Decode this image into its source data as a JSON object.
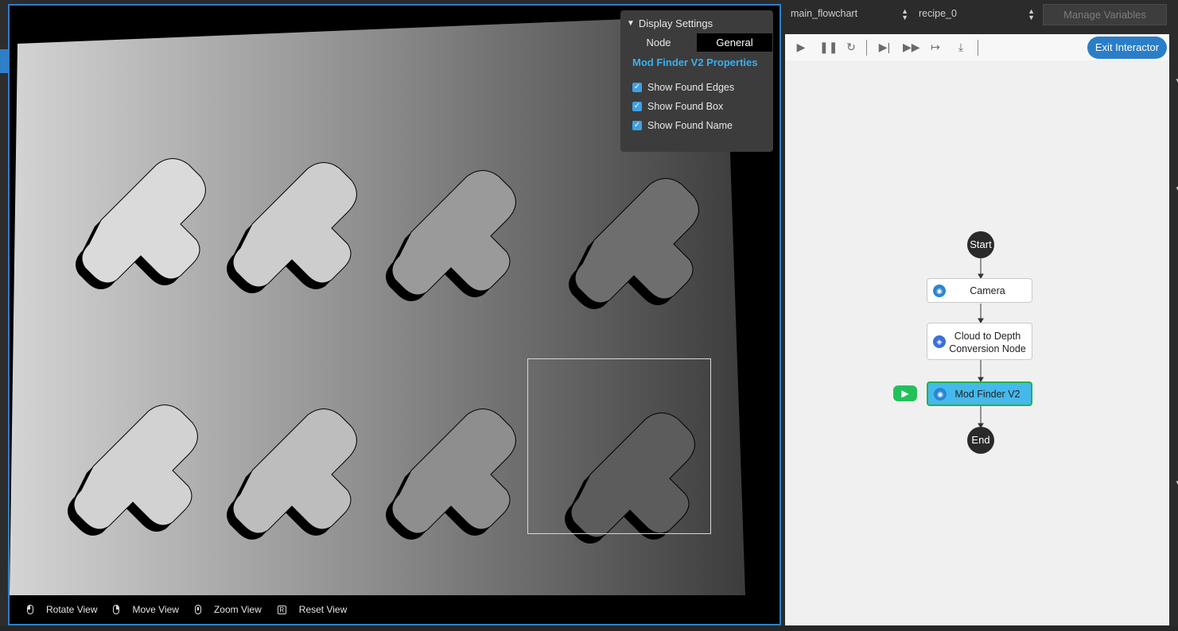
{
  "viewer": {
    "display_settings": {
      "title": "Display Settings",
      "tabs": [
        {
          "label": "Node",
          "active": false
        },
        {
          "label": "General",
          "active": true
        }
      ],
      "section_title": "Mod Finder V2 Properties",
      "options": [
        {
          "label": "Show Found Edges",
          "checked": true
        },
        {
          "label": "Show Found Box",
          "checked": true
        },
        {
          "label": "Show Found Name",
          "checked": true
        }
      ]
    },
    "view_controls": [
      {
        "label": "Rotate View",
        "icon": "mouse-left-icon"
      },
      {
        "label": "Move View",
        "icon": "mouse-right-icon"
      },
      {
        "label": "Zoom View",
        "icon": "mouse-wheel-icon"
      },
      {
        "label": "Reset View",
        "icon": "key-r-icon",
        "key": "R"
      }
    ]
  },
  "topbar": {
    "flowchart_select": "main_flowchart",
    "recipe_select": "recipe_0",
    "manage_variables": "Manage Variables"
  },
  "toolbar": {
    "buttons": [
      "play-icon",
      "pause-icon",
      "refresh-icon",
      "step-icon",
      "fast-forward-icon",
      "step-over-icon",
      "step-into-icon"
    ],
    "exit_label": "Exit Interactor"
  },
  "flowchart": {
    "start": "Start",
    "end": "End",
    "nodes": [
      {
        "label": "Camera",
        "icon": "camera-icon",
        "active": false
      },
      {
        "label": "Cloud to Depth Conversion Node",
        "icon": "cube-icon",
        "active": false
      },
      {
        "label": "Mod Finder V2",
        "icon": "camera-icon",
        "active": true
      }
    ]
  },
  "colors": {
    "accent": "#2f7fc6",
    "active_node": "#45b9ec",
    "active_border": "#22b34a",
    "run_badge": "#22c15a",
    "properties_title": "#39b0f0"
  }
}
